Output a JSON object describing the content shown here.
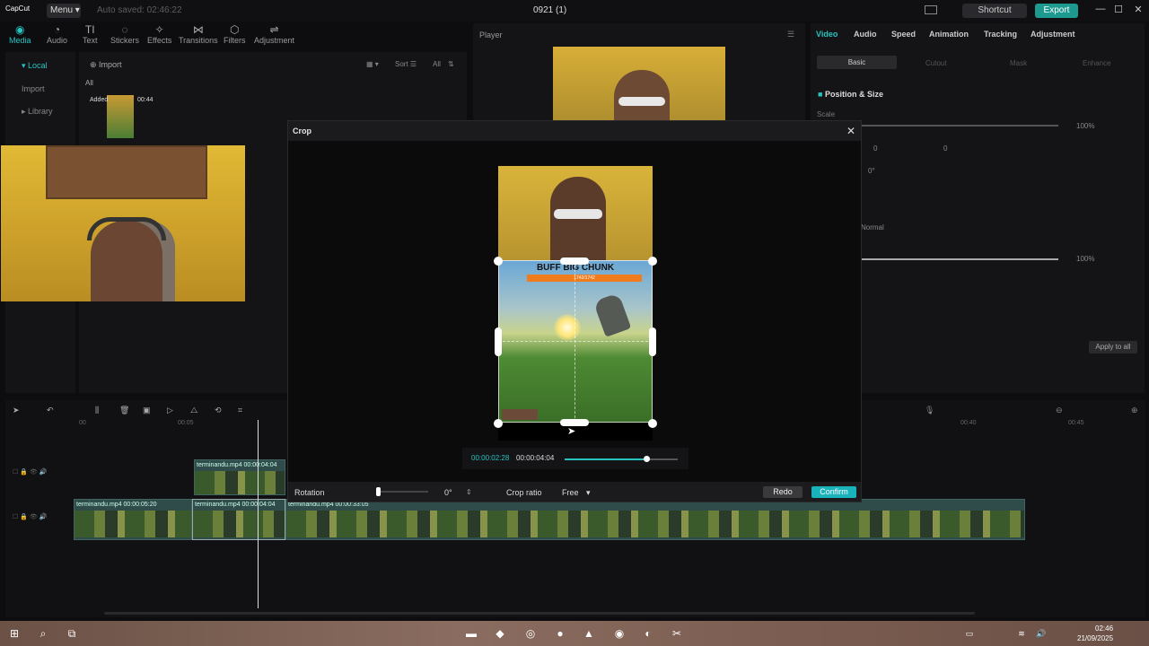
{
  "app": {
    "logo": "CapCut",
    "menu_label": "Menu",
    "autosave": "Auto saved: 02:46:22",
    "project_title": "0921 (1)",
    "shortcut_label": "Shortcut",
    "export_label": "Export",
    "win_min": "—",
    "win_max": "☐",
    "win_close": "✕"
  },
  "toolbar": {
    "items": [
      {
        "label": "Media",
        "icon": "media-icon"
      },
      {
        "label": "Audio",
        "icon": "audio-icon"
      },
      {
        "label": "Text",
        "icon": "text-icon"
      },
      {
        "label": "Stickers",
        "icon": "stickers-icon"
      },
      {
        "label": "Effects",
        "icon": "effects-icon"
      },
      {
        "label": "Transitions",
        "icon": "transitions-icon"
      },
      {
        "label": "Filters",
        "icon": "filters-icon"
      },
      {
        "label": "Adjustment",
        "icon": "adjustment-icon"
      }
    ]
  },
  "sidebar": {
    "local": "Local",
    "import": "Import",
    "library": "Library"
  },
  "media": {
    "import_label": "Import",
    "sort_label": "Sort",
    "all_label": "All",
    "filter_all": "All",
    "clip_added": "Added",
    "clip_duration": "00:44"
  },
  "player": {
    "title": "Player"
  },
  "props": {
    "tabs": [
      "Video",
      "Audio",
      "Speed",
      "Animation",
      "Tracking",
      "Adjustment"
    ],
    "subtabs": [
      "Basic",
      "Cutout",
      "Mask",
      "Enhance"
    ],
    "section": "Position & Size",
    "scale_label": "Scale",
    "scale_value": "100%",
    "pos_x": "0",
    "pos_y": "0",
    "rotate": "0°",
    "blend": "Normal",
    "opacity_value": "100%",
    "apply_all": "Apply to all"
  },
  "crop": {
    "title": "Crop",
    "close": "✕",
    "boss_title": "BUFF BIG CHUNK",
    "boss_hp": "1742/1742",
    "time_current": "00:00:02:28",
    "time_total": "00:00:04:04",
    "seek_progress": 0.72,
    "rotation_label": "Rotation",
    "rotation_value": "0°",
    "crop_ratio_label": "Crop ratio",
    "crop_ratio_value": "Free",
    "redo_label": "Redo",
    "confirm_label": "Confirm"
  },
  "timeline": {
    "clips": [
      {
        "label": "terminandu.mp4   00:00:04:04"
      },
      {
        "label": "terminandu.mp4   00:00:05:20"
      },
      {
        "label": "terminandu.mp4   00:00:04:04"
      },
      {
        "label": "terminandu.mp4   00:00:33:05"
      }
    ],
    "ruler": [
      "00",
      "00:05",
      "00:40",
      "00:45"
    ]
  },
  "taskbar": {
    "time": "02:46",
    "date": "21/09/2025"
  }
}
